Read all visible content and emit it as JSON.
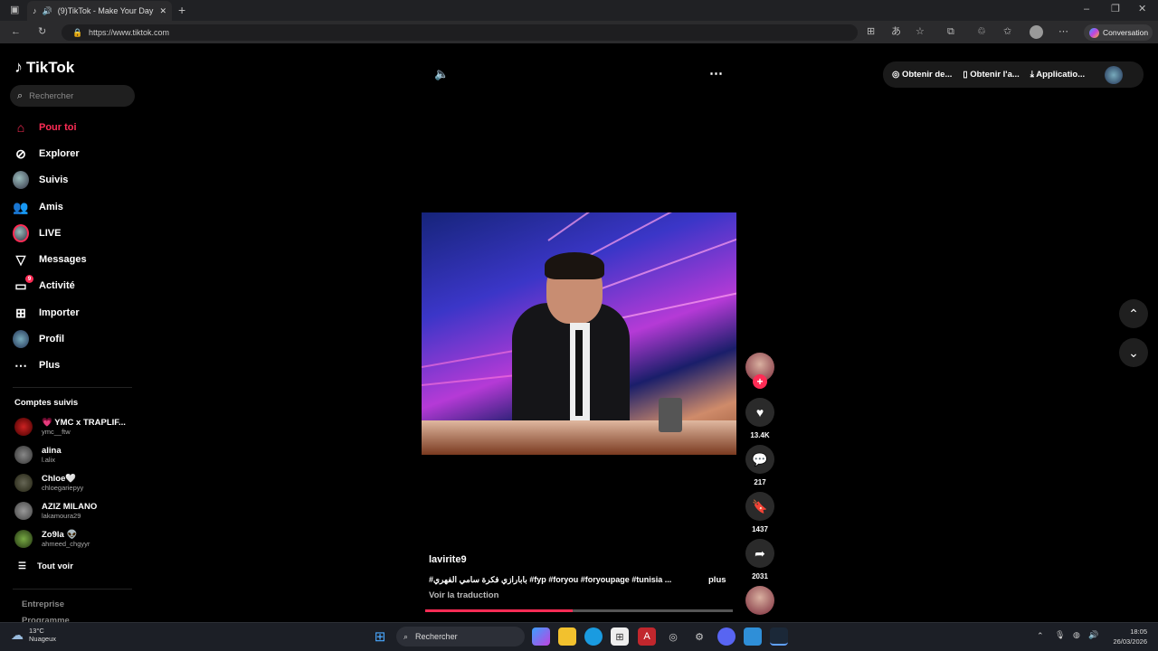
{
  "browser": {
    "tab_title": "(9)TikTok - Make Your Day",
    "url": "https://www.tiktok.com",
    "conversation_label": "Conversation"
  },
  "sidebar": {
    "logo": "TikTok",
    "search_placeholder": "Rechercher",
    "nav": [
      {
        "label": "Pour toi",
        "icon": "home-icon"
      },
      {
        "label": "Explorer",
        "icon": "compass-icon"
      },
      {
        "label": "Suivis",
        "icon": "following-avatar-icon"
      },
      {
        "label": "Amis",
        "icon": "friends-icon"
      },
      {
        "label": "LIVE",
        "icon": "live-icon"
      },
      {
        "label": "Messages",
        "icon": "send-icon"
      },
      {
        "label": "Activité",
        "icon": "activity-icon",
        "badge": "9"
      },
      {
        "label": "Importer",
        "icon": "upload-icon"
      },
      {
        "label": "Profil",
        "icon": "profile-avatar-icon"
      },
      {
        "label": "Plus",
        "icon": "more-icon"
      }
    ],
    "following_title": "Comptes suivis",
    "following": [
      {
        "name": "💗 YMC x TRAPLIF...",
        "handle": "ymc__ftw"
      },
      {
        "name": "alina",
        "handle": "l.alix"
      },
      {
        "name": "Chloe🤍",
        "handle": "chloegariepyy"
      },
      {
        "name": "AZIZ MILANO",
        "handle": "lakamoura29"
      },
      {
        "name": "Zo9la 👽",
        "handle": "ahmeed_chgyyr"
      }
    ],
    "see_all": "Tout voir",
    "footer": [
      "Entreprise",
      "Programme"
    ]
  },
  "topbar": {
    "items": [
      "Obtenir de...",
      "Obtenir l'a...",
      "Applicatio..."
    ]
  },
  "video": {
    "author": "lavirite9",
    "caption": "#بابارازي فكرة سامي الفهري #fyp #foryou #foryoupage #tunisia ...",
    "more": "plus",
    "translate": "Voir la traduction",
    "progress": 0.48
  },
  "actions": {
    "likes": "13.4K",
    "comments": "217",
    "saves": "1437",
    "shares": "2031"
  },
  "taskbar": {
    "temp": "13°C",
    "weather": "Nuageux",
    "search": "Rechercher",
    "time": "18:05",
    "date": "26/03/2026"
  },
  "colors": {
    "accent": "#fe2c55"
  }
}
